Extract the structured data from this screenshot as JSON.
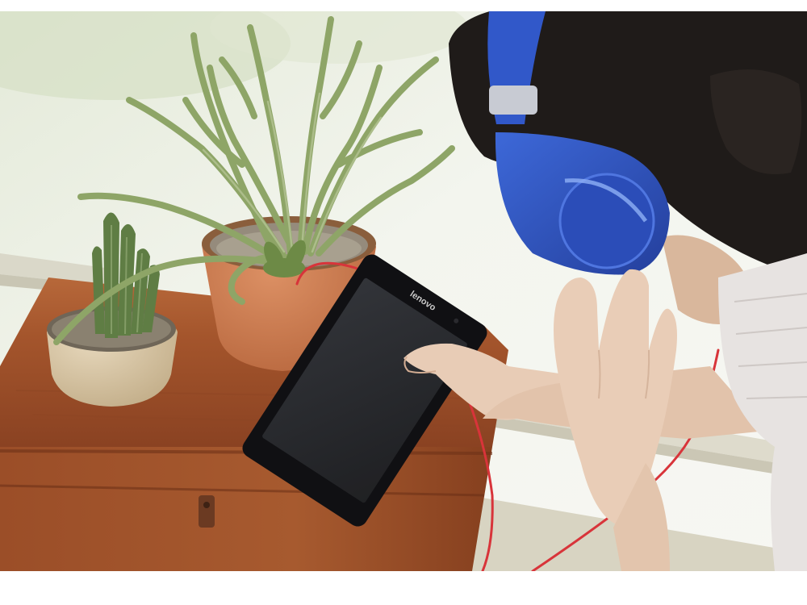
{
  "photo": {
    "tablet_brand": "lenovo",
    "colors": {
      "window_light": "#eef2ec",
      "window_frame": "#e2e0d4",
      "wood_box": "#a4552c",
      "wood_box_dark": "#7c3a1c",
      "terracotta_pot": "#c97a4e",
      "beige_pot": "#d8c6a6",
      "cactus_green": "#7f9a62",
      "tablet_body": "#121214",
      "tablet_screen": "#1c1d21",
      "headphone_blue": "#2f57c8",
      "cable_red": "#d8343a",
      "hair": "#201c1a",
      "skin": "#e9cdb7",
      "shirt": "#e6e2df"
    }
  }
}
